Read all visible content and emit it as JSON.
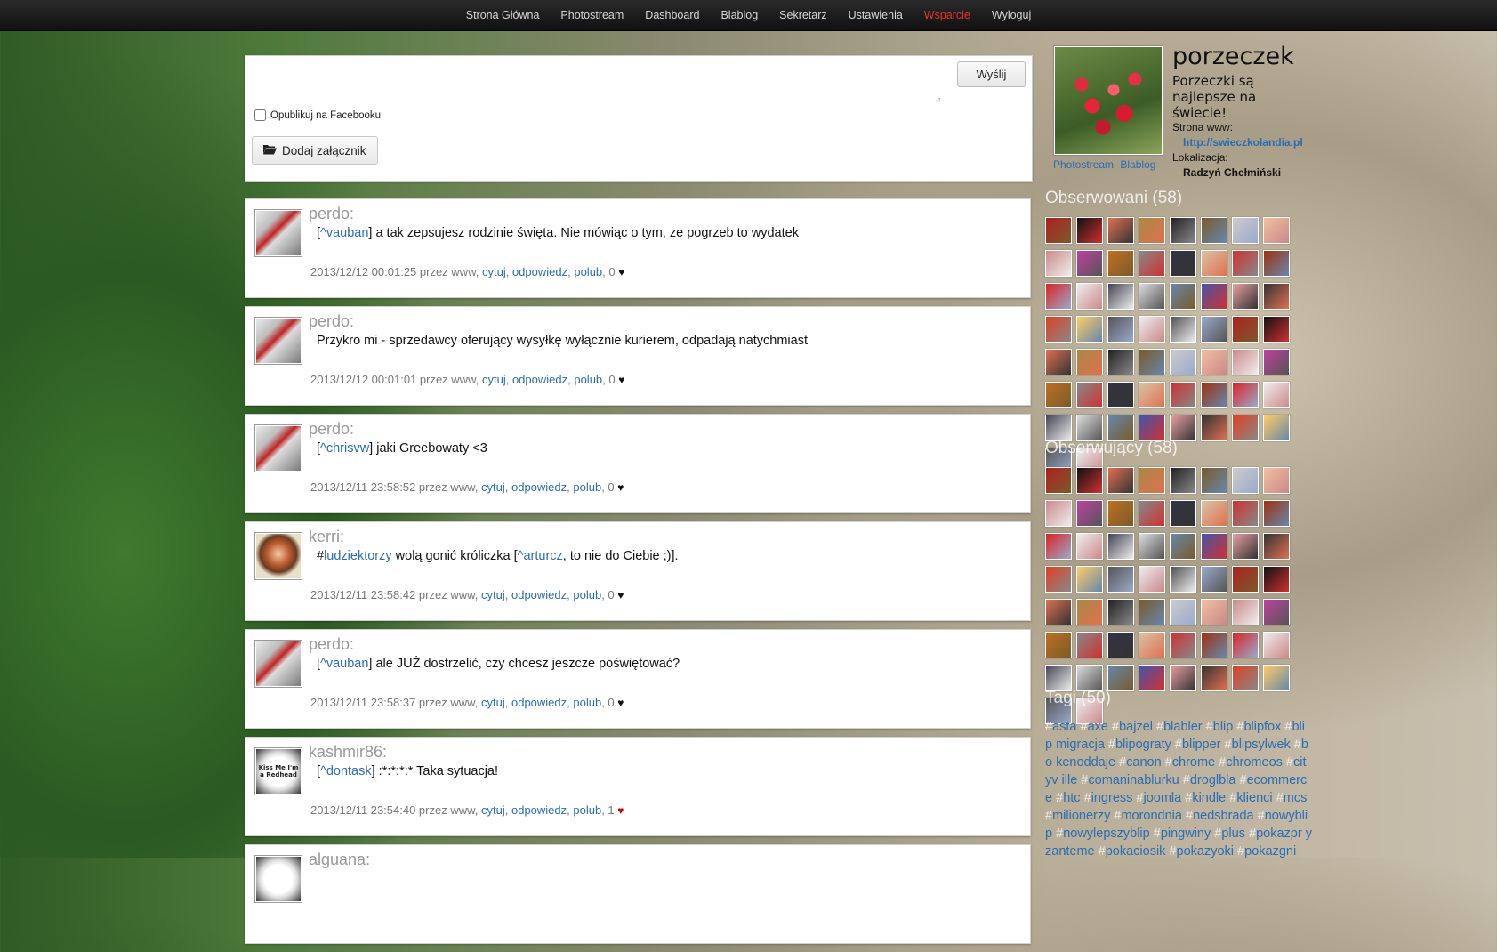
{
  "nav": [
    "Strona Główna",
    "Photostream",
    "Dashboard",
    "Blablog",
    "Sekretarz",
    "Ustawienia",
    "Wsparcie",
    "Wyloguj"
  ],
  "composer": {
    "send_label": "Wyślij",
    "facebook_label": "Opublikuj na Facebooku",
    "attach_label": "Dodaj załącznik"
  },
  "posts": [
    {
      "author": "perdo:",
      "mention": "^vauban",
      "text_pre": "[",
      "text_post": "] a tak zepsujesz rodzinie święta. Nie mówiąc o tym, ze pogrzeb to wydatek",
      "date": "2013/12/12 00:01:25 przez www,",
      "likes": "0",
      "liked": false
    },
    {
      "author": "perdo:",
      "mention": "",
      "text_pre": "Przykro mi - sprzedawcy oferujący wysyłkę wyłącznie kurierem, odpadają natychmiast",
      "text_post": "",
      "date": "2013/12/12 00:01:01 przez www,",
      "likes": "0",
      "liked": false
    },
    {
      "author": "perdo:",
      "mention": "^chrisvw",
      "text_pre": "[",
      "text_post": "] jaki Greebowaty <3",
      "date": "2013/12/11 23:58:52 przez www,",
      "likes": "0",
      "liked": false
    },
    {
      "author": "kerri:",
      "mention": "ludziektorzy",
      "text_pre": "#",
      "text_post": " wolą gonić króliczka [",
      "mention2": "^arturcz",
      "text_post2": ", to nie do Ciebie ;)].",
      "date": "2013/12/11 23:58:42 przez www,",
      "likes": "0",
      "liked": false
    },
    {
      "author": "perdo:",
      "mention": "^vauban",
      "text_pre": "[",
      "text_post": "] ale JUŻ dostrzelić, czy chcesz jeszcze poświętować?",
      "date": "2013/12/11 23:58:37 przez www,",
      "likes": "0",
      "liked": false
    },
    {
      "author": "kashmir86:",
      "mention": "^dontask",
      "text_pre": "[",
      "text_post": "] :*:*:*:* Taka sytuacja!",
      "date": "2013/12/11 23:54:40 przez www,",
      "likes": "1",
      "liked": true
    },
    {
      "author": "alguana:",
      "mention": "",
      "text_pre": "",
      "text_post": "",
      "date": "",
      "likes": "",
      "liked": false
    }
  ],
  "post_actions": {
    "quote": "cytuj",
    "reply": "odpowiedz",
    "like": "polub"
  },
  "avatar_text": {
    "kashmir": "Kiss Me I'm a Redhead"
  },
  "profile": {
    "username": "porzeczek",
    "tagline": "Porzeczki są najlepsze na świecie!",
    "www_label": "Strona www:",
    "www_value": "http://swieczkolandia.pl",
    "location_label": "Lokalizacja:",
    "location_value": "Radzyń Chełmiński",
    "link_photostream": "Photostream",
    "link_blablog": "Blablog"
  },
  "following_title": "Obserwowani (58)",
  "followers_title": "Obserwujący (58)",
  "tags_title": "Tagi (50)",
  "tags": [
    "asta",
    "axe",
    "bajzel",
    "blabler",
    "blip",
    "blipfox",
    "blip migracja",
    "blipograty",
    "blipper",
    "blipsylwek",
    "bo kenoddaje",
    "canon",
    "chrome",
    "chromeos",
    "cityv ille",
    "comaninablurku",
    "droglbla",
    "ecommerce",
    "htc",
    "ingress",
    "joomla",
    "kindle",
    "klienci",
    "mcs",
    "milionerzy",
    "morondnia",
    "nedsbrada",
    "nowybli p",
    "nowylepszyblip",
    "pingwiny",
    "plus",
    "pokazpr yzanteme",
    "pokaciosik",
    "pokazyoki",
    "pokazgni"
  ],
  "colors": {
    "link": "#2a6db5",
    "support": "#e8322a",
    "heart_red": "#d10000"
  }
}
